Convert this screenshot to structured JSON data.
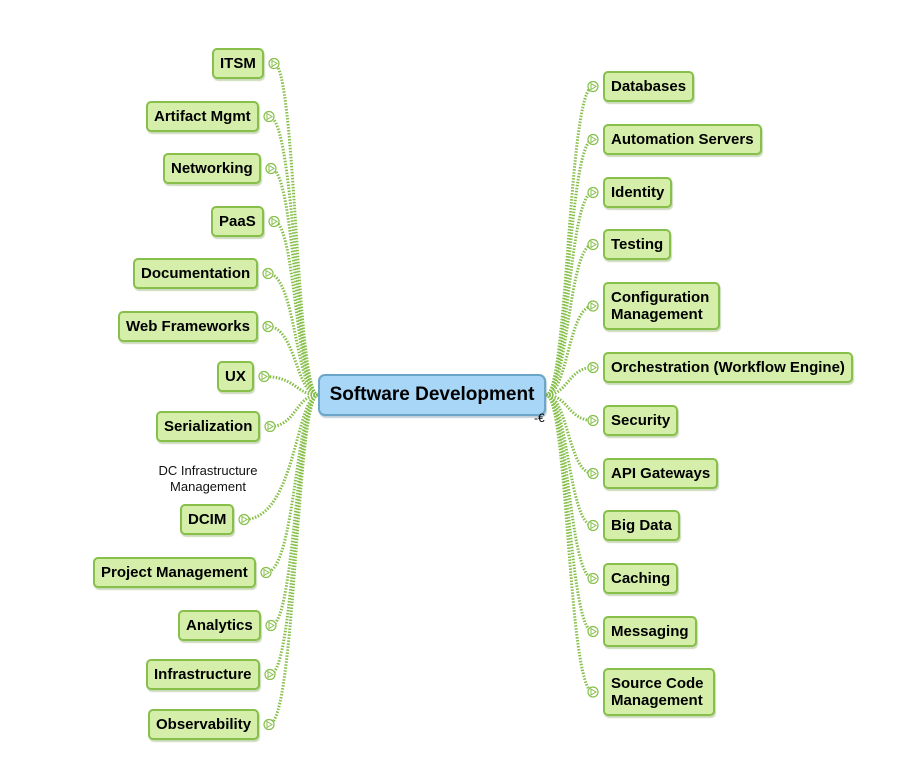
{
  "diagram": {
    "type": "mind-map",
    "root": {
      "label": "Software Development",
      "collapse_marker": "-€"
    },
    "colors": {
      "root_fill": "#a7d6f7",
      "root_border": "#6ba6c8",
      "node_fill": "#d5efaa",
      "node_border": "#86bf4a",
      "connector": "#86bf4a"
    },
    "left_branches": [
      {
        "label": "ITSM"
      },
      {
        "label": "Artifact Mgmt"
      },
      {
        "label": "Networking"
      },
      {
        "label": "PaaS"
      },
      {
        "label": "Documentation"
      },
      {
        "label": "Web Frameworks"
      },
      {
        "label": "UX"
      },
      {
        "label": "Serialization"
      },
      {
        "label": "DCIM",
        "note": "DC Infrastructure Management"
      },
      {
        "label": "Project Management"
      },
      {
        "label": "Analytics"
      },
      {
        "label": "Infrastructure"
      },
      {
        "label": "Observability"
      }
    ],
    "right_branches": [
      {
        "label": "Databases"
      },
      {
        "label": "Automation Servers"
      },
      {
        "label": "Identity"
      },
      {
        "label": "Testing"
      },
      {
        "label": "Configuration Management"
      },
      {
        "label": "Orchestration (Workflow Engine)"
      },
      {
        "label": "Security"
      },
      {
        "label": "API Gateways"
      },
      {
        "label": "Big Data"
      },
      {
        "label": "Caching"
      },
      {
        "label": "Messaging"
      },
      {
        "label": "Source Code Management"
      }
    ]
  }
}
